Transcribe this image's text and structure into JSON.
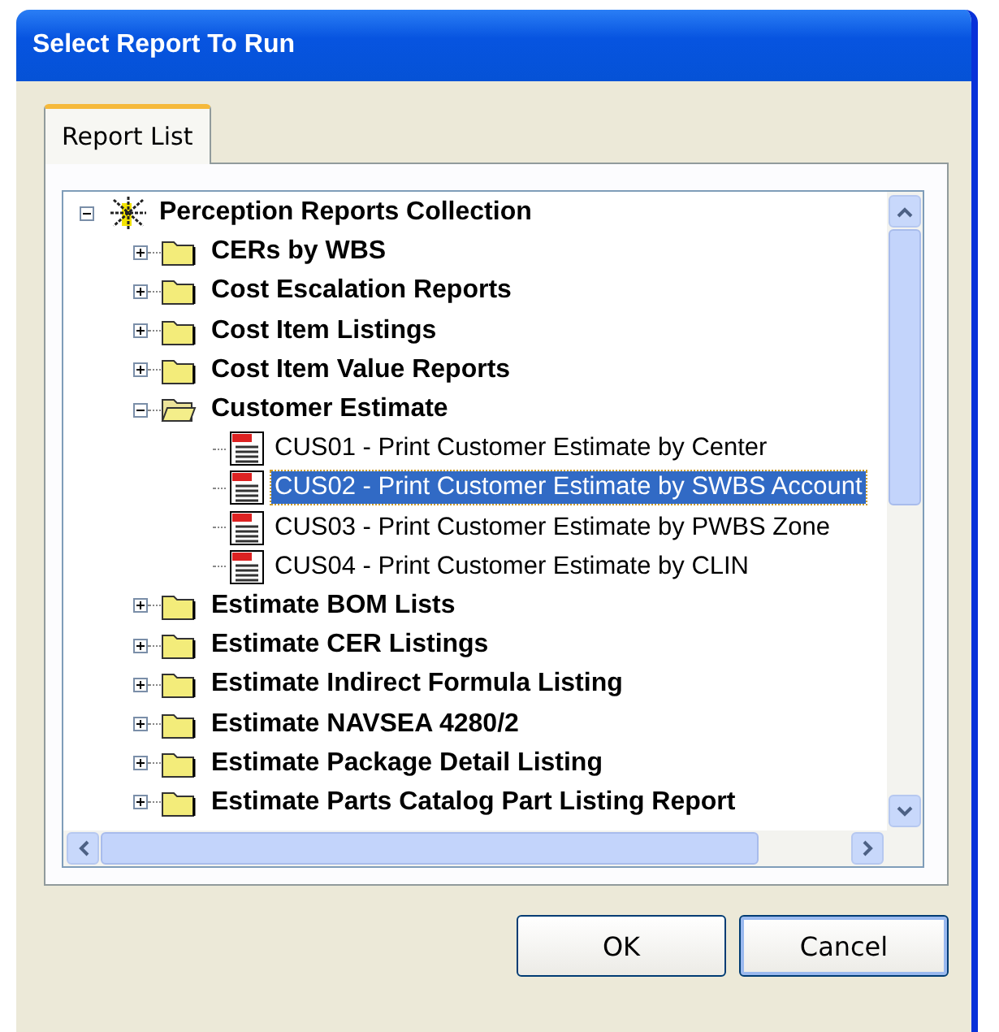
{
  "window": {
    "title": "Select Report To Run"
  },
  "tabs": [
    {
      "label": "Report List",
      "selected": true
    }
  ],
  "tree": {
    "label": "Perception Reports Collection",
    "expanded": true,
    "children": [
      {
        "kind": "folder",
        "label": "CERs by WBS",
        "expanded": false
      },
      {
        "kind": "folder",
        "label": "Cost Escalation Reports",
        "expanded": false
      },
      {
        "kind": "folder",
        "label": "Cost Item Listings",
        "expanded": false
      },
      {
        "kind": "folder",
        "label": "Cost Item Value Reports",
        "expanded": false
      },
      {
        "kind": "folder",
        "label": "Customer Estimate",
        "expanded": true,
        "children": [
          {
            "kind": "report",
            "label": "CUS01 - Print Customer Estimate by Center",
            "selected": false
          },
          {
            "kind": "report",
            "label": "CUS02 - Print Customer Estimate by SWBS Account",
            "selected": true
          },
          {
            "kind": "report",
            "label": "CUS03 - Print Customer Estimate by PWBS Zone",
            "selected": false
          },
          {
            "kind": "report",
            "label": "CUS04 - Print Customer Estimate by CLIN",
            "selected": false
          }
        ]
      },
      {
        "kind": "folder",
        "label": "Estimate BOM Lists",
        "expanded": false
      },
      {
        "kind": "folder",
        "label": "Estimate CER Listings",
        "expanded": false
      },
      {
        "kind": "folder",
        "label": "Estimate Indirect Formula Listing",
        "expanded": false
      },
      {
        "kind": "folder",
        "label": "Estimate NAVSEA 4280/2",
        "expanded": false
      },
      {
        "kind": "folder",
        "label": "Estimate Package Detail Listing",
        "expanded": false
      },
      {
        "kind": "folder",
        "label": "Estimate Parts Catalog Part Listing Report",
        "expanded": false
      }
    ]
  },
  "buttons": [
    "OK",
    "Cancel"
  ]
}
